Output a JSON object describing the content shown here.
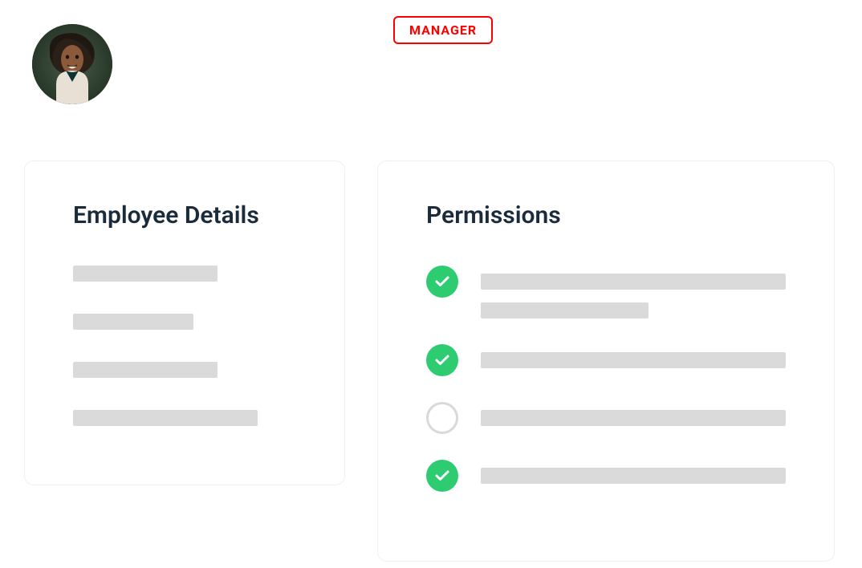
{
  "header": {
    "role_label": "MANAGER"
  },
  "details_card": {
    "title": "Employee Details"
  },
  "permissions_card": {
    "title": "Permissions",
    "items": [
      {
        "checked": true,
        "lines": 2
      },
      {
        "checked": true,
        "lines": 1
      },
      {
        "checked": false,
        "lines": 1
      },
      {
        "checked": true,
        "lines": 1
      }
    ]
  },
  "colors": {
    "accent_red": "#ff0000",
    "check_green": "#2ecc71",
    "text_dark": "#1a2b3c",
    "placeholder_gray": "#dadada",
    "ring_gray": "#d9d9d9"
  }
}
